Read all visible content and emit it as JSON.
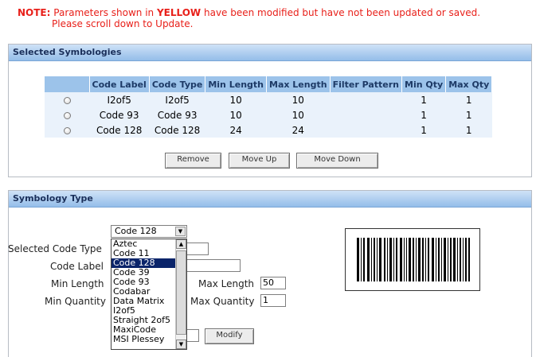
{
  "note": {
    "lead": "NOTE:",
    "text1": "Parameters shown in",
    "highlight": "YELLOW",
    "text2": "have been modified but have not been updated or saved.",
    "line2": "Please scroll down to Update."
  },
  "selected_panel": {
    "title": "Selected Symbologies",
    "columns": [
      "Code Label",
      "Code Type",
      "Min Length",
      "Max Length",
      "Filter Pattern",
      "Min Qty",
      "Max Qty"
    ],
    "rows": [
      {
        "label": "I2of5",
        "type": "I2of5",
        "min": "10",
        "max": "10",
        "filter": "",
        "minq": "1",
        "maxq": "1"
      },
      {
        "label": "Code 93",
        "type": "Code 93",
        "min": "10",
        "max": "10",
        "filter": "",
        "minq": "1",
        "maxq": "1"
      },
      {
        "label": "Code 128",
        "type": "Code 128",
        "min": "24",
        "max": "24",
        "filter": "",
        "minq": "1",
        "maxq": "1"
      }
    ],
    "buttons": {
      "remove": "Remove",
      "move_up": "Move Up",
      "move_down": "Move Down"
    }
  },
  "type_panel": {
    "title": "Symbology Type",
    "labels": {
      "code_type": "Selected Code Type",
      "code_label": "Code Label",
      "min_length": "Min Length",
      "max_length": "Max Length",
      "min_quantity": "Min Quantity",
      "max_quantity": "Max Quantity"
    },
    "selected_code_type": "Code 128",
    "max_length_value": "50",
    "max_quantity_value": "1",
    "modify_label": "Modify",
    "dropdown_options": [
      "Aztec",
      "Code 11",
      "Code 128",
      "Code 39",
      "Code 93",
      "Codabar",
      "Data Matrix",
      "I2of5",
      "Straight 2of5",
      "MaxiCode",
      "MSI Plessey"
    ],
    "dropdown_selected_index": 2
  },
  "colors": {
    "note": "#e8201a",
    "header_bg": "#94bde9",
    "table_header": "#9cc3ea",
    "row_bg": "#eaf2fb",
    "selected_option": "#0a246a"
  },
  "icons": [
    "radio-icon",
    "dropdown-arrow-icon",
    "scroll-up-icon",
    "scroll-down-icon",
    "barcode-icon"
  ]
}
